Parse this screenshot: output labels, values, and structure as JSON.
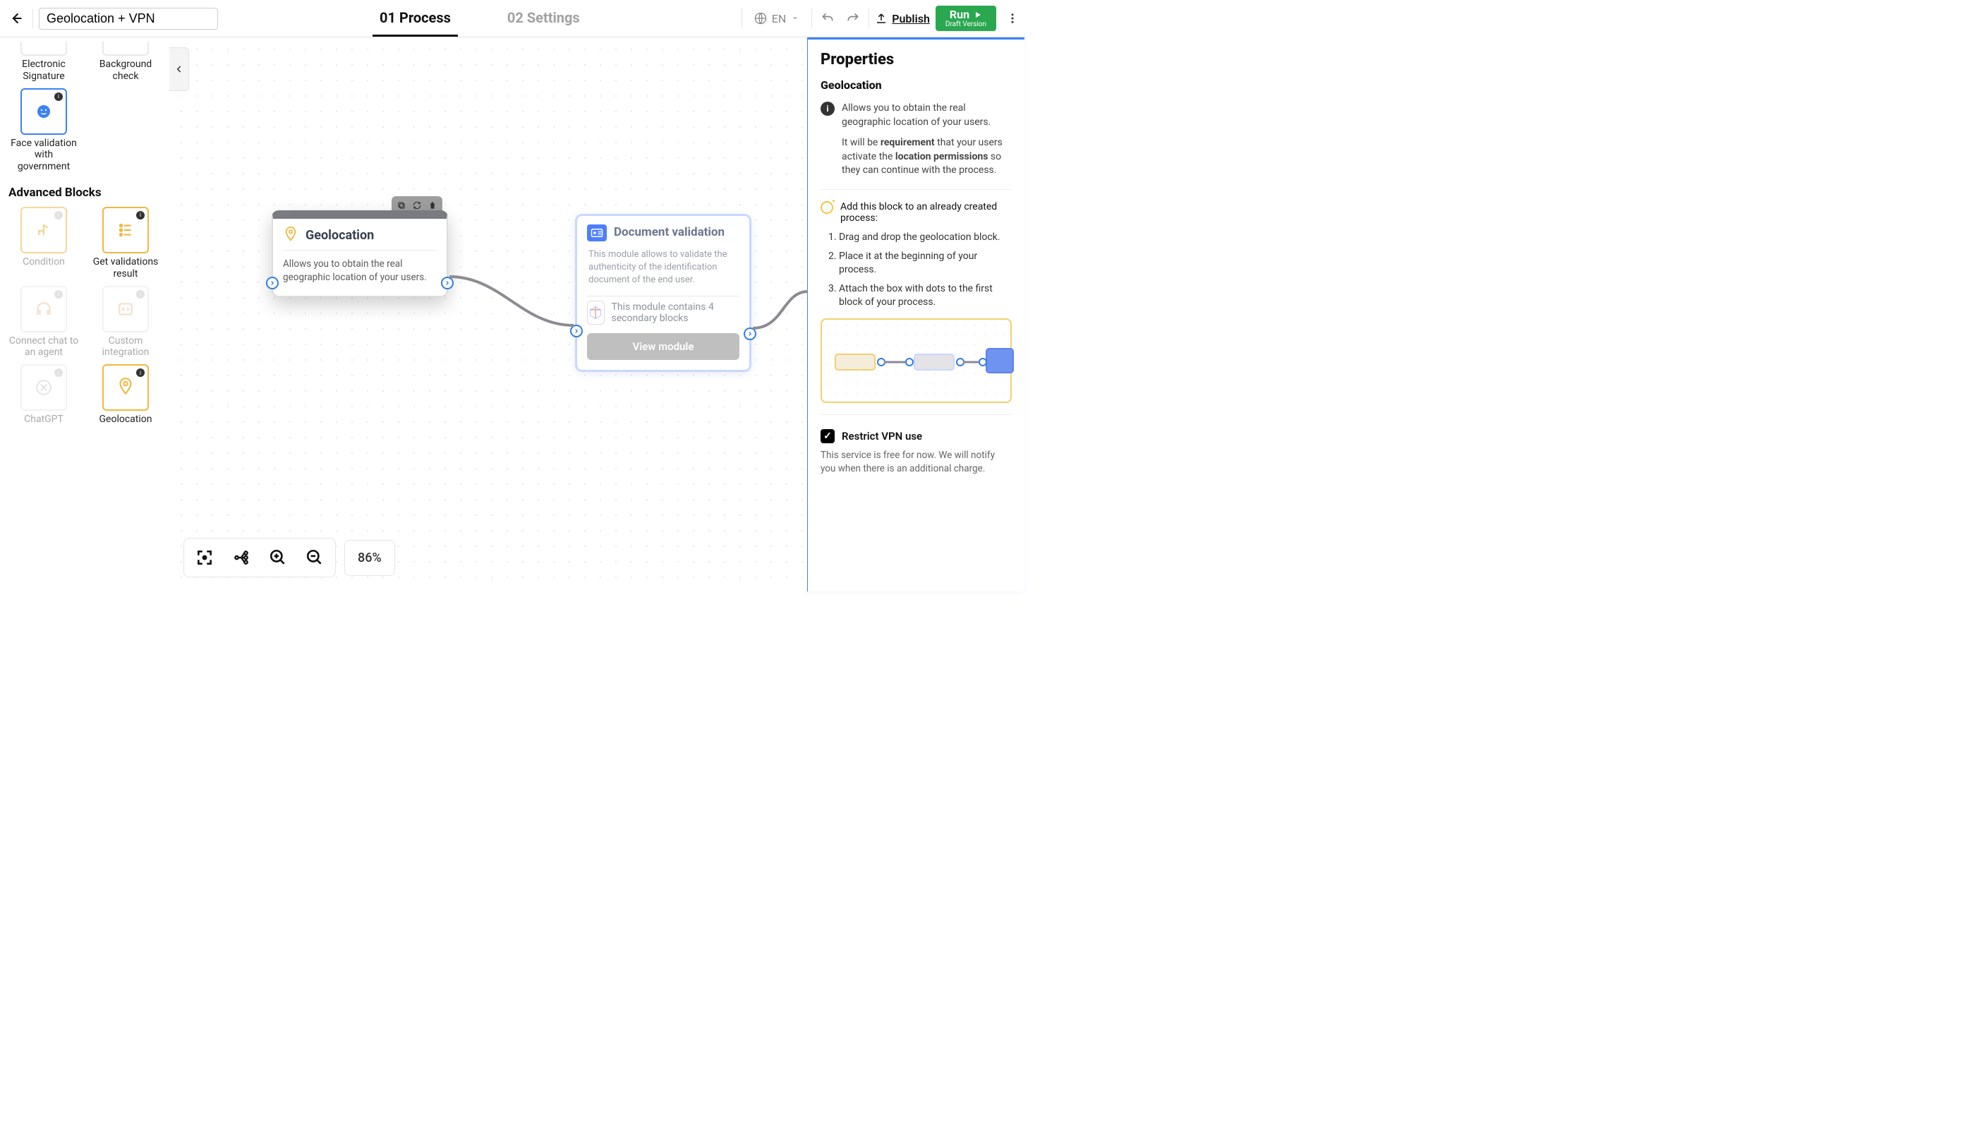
{
  "header": {
    "title": "Geolocation + VPN",
    "tabs": [
      {
        "label": "01 Process",
        "active": true
      },
      {
        "label": "02 Settings",
        "active": false
      }
    ],
    "language": "EN",
    "publish_label": "Publish",
    "run": {
      "top": "Run",
      "bottom": "Draft Version"
    }
  },
  "sidebar": {
    "top_row": [
      {
        "label": "Electronic Signature",
        "dim": false
      },
      {
        "label": "Background check",
        "dim": false
      }
    ],
    "face_validation": {
      "label": "Face validation with government",
      "active": true
    },
    "advanced_header": "Advanced Blocks",
    "advanced": [
      {
        "label": "Condition",
        "dim": true,
        "orange": true
      },
      {
        "label": "Get validations result",
        "dim": false,
        "orange": true
      },
      {
        "label": "Connect chat to an agent",
        "dim": true,
        "orange": false
      },
      {
        "label": "Custom integration",
        "dim": true,
        "orange": false
      },
      {
        "label": "ChatGPT",
        "dim": true,
        "orange": false
      },
      {
        "label": "Geolocation",
        "dim": false,
        "orange": true
      }
    ]
  },
  "canvas": {
    "geo": {
      "title": "Geolocation",
      "desc": "Allows you to obtain the real geographic location of your users."
    },
    "doc": {
      "title": "Document validation",
      "desc": "This module allows to validate the authenticity of the identification document of the end user.",
      "module_line": "This module contains 4 secondary blocks",
      "view_label": "View module"
    },
    "zoom": "86%"
  },
  "props": {
    "title": "Properties",
    "subtitle": "Geolocation",
    "info_line": "Allows you to obtain the real geographic location of your users.",
    "req_pre": "It will be ",
    "req_bold1": "requirement",
    "req_mid": " that your users activate the ",
    "req_bold2": "location permissions",
    "req_post": " so they can continue with the process.",
    "add_block_line": "Add this block to an already created process:",
    "steps": [
      "Drag and drop the geolocation block.",
      "Place it at the beginning of your process.",
      "Attach the box with dots to the first block of your process."
    ],
    "vpn_label": "Restrict VPN use",
    "vpn_note": "This service is free for now. We will notify you when there is an additional charge."
  }
}
